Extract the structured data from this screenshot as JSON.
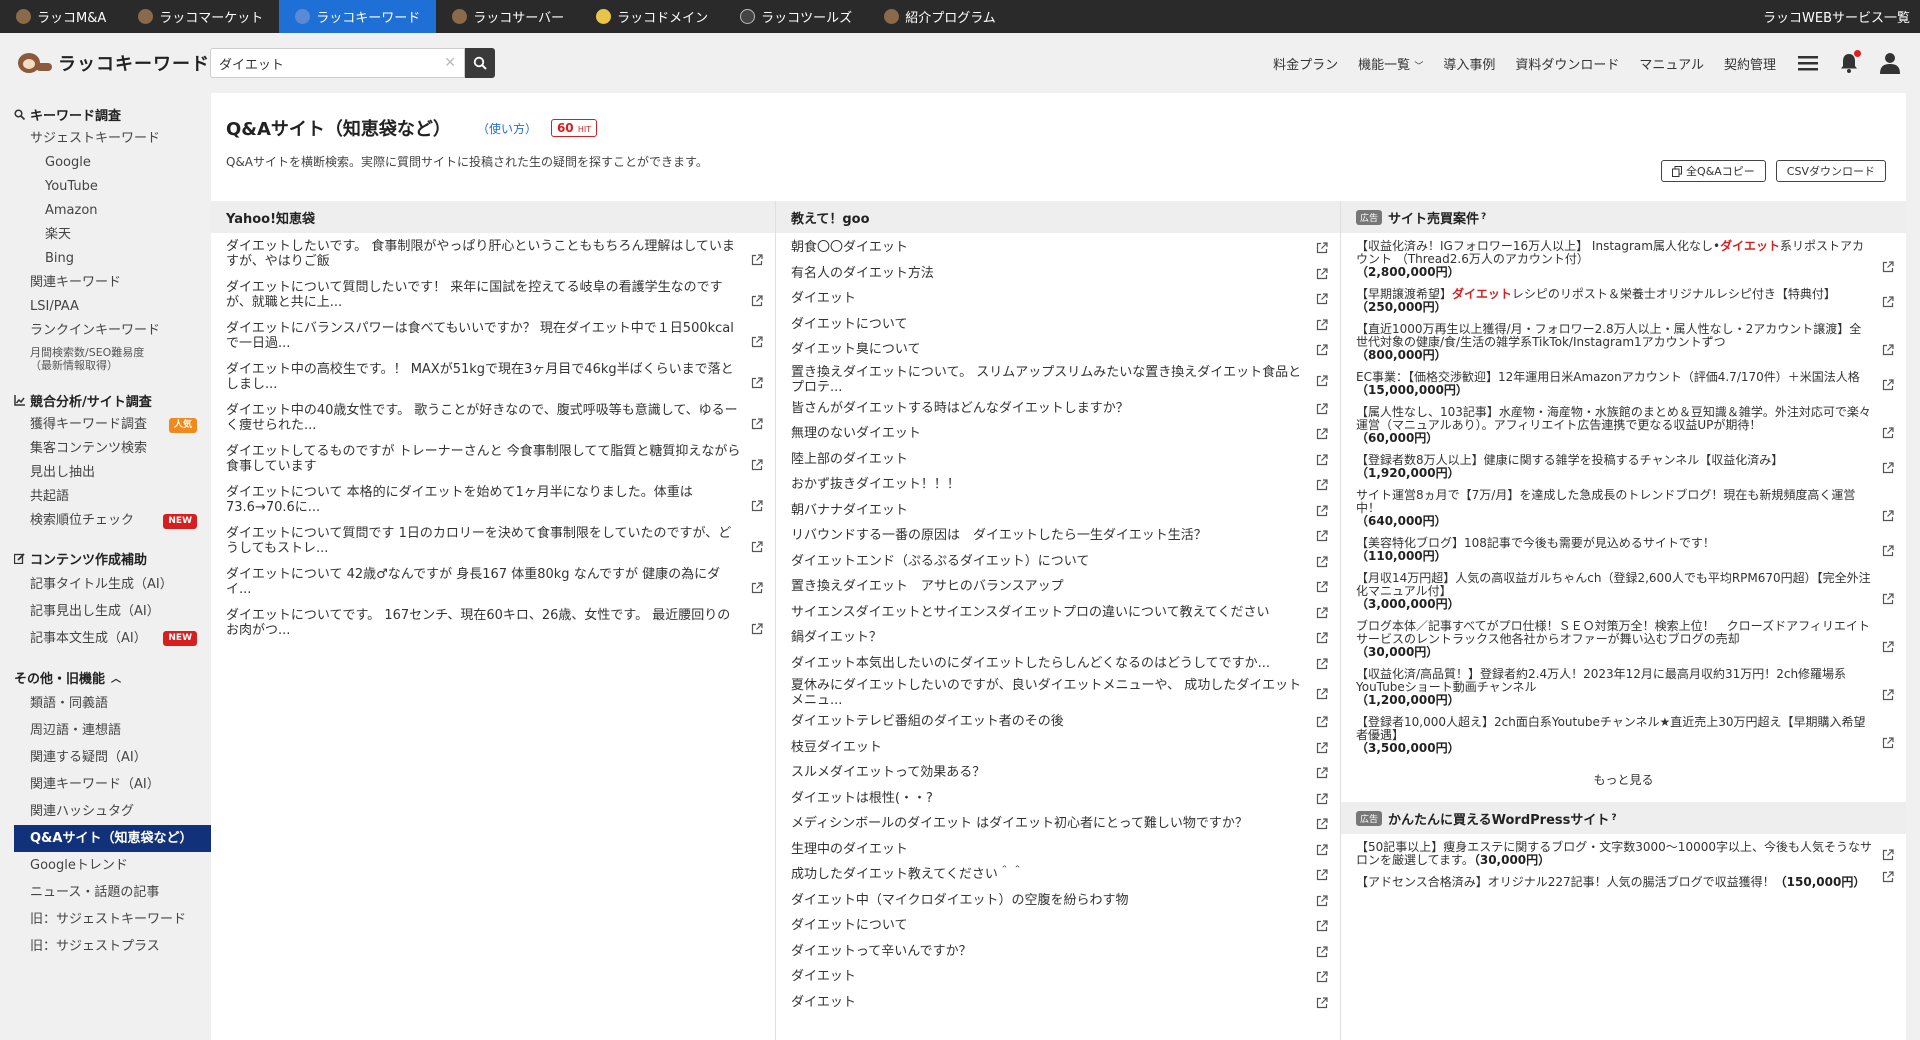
{
  "service_bar": {
    "items": [
      {
        "label": "ラッコM&A",
        "active": false
      },
      {
        "label": "ラッコマーケット",
        "active": false
      },
      {
        "label": "ラッコキーワード",
        "active": true
      },
      {
        "label": "ラッコサーバー",
        "active": false
      },
      {
        "label": "ラッコドメイン",
        "active": false
      },
      {
        "label": "ラッコツールズ",
        "active": false
      },
      {
        "label": "紹介プログラム",
        "active": false
      }
    ],
    "right_label": "ラッコWEBサービス一覧"
  },
  "header": {
    "logo_text": "ラッコキーワード",
    "search_value": "ダイエット",
    "nav": [
      "料金プラン",
      "機能一覧",
      "導入事例",
      "資料ダウンロード",
      "マニュアル",
      "契約管理"
    ]
  },
  "sidebar": {
    "sections": [
      {
        "title": "キーワード調査",
        "items": [
          "サジェストキーワード",
          "Google",
          "YouTube",
          "Amazon",
          "楽天",
          "Bing",
          "関連キーワード",
          "LSI/PAA",
          "ランクインキーワード",
          "月間検索数/SEO難易度",
          "（最新情報取得）"
        ]
      },
      {
        "title": "競合分析/サイト調査",
        "items": [
          "獲得キーワード調査",
          "集客コンテンツ検索",
          "見出し抽出",
          "共起語",
          "検索順位チェック"
        ],
        "badges": {
          "popular": "人気",
          "new": "NEW"
        }
      },
      {
        "title": "コンテンツ作成補助",
        "items": [
          "記事タイトル生成（AI）",
          "記事見出し生成（AI）",
          "記事本文生成（AI）"
        ]
      },
      {
        "title": "その他・旧機能",
        "items": [
          "類語・同義語",
          "周辺語・連想語",
          "関連する疑問（AI）",
          "関連キーワード（AI）",
          "関連ハッシュタグ",
          "Q&Aサイト（知恵袋など）",
          "Googleトレンド",
          "ニュース・話題の記事",
          "旧：サジェストキーワード",
          "旧：サジェストプラス"
        ]
      }
    ]
  },
  "page": {
    "title": "Q&Aサイト（知恵袋など）",
    "help_link": "（使い方）",
    "hit_count": "60",
    "hit_unit": "HIT",
    "description": "Q&Aサイトを横断検索。実際に質問サイトに投稿された生の疑問を探すことができます。",
    "copy_button": "全Q&Aコピー",
    "csv_button": "CSVダウンロード"
  },
  "yahoo": {
    "header": "Yahoo!知恵袋",
    "rows": [
      "ダイエットしたいです。 食事制限がやっぱり肝心ということももちろん理解はしていますが、やはりご飯",
      "ダイエットについて質問したいです！ 来年に国試を控えてる岐阜の看護学生なのですが、就職と共に上...",
      "ダイエットにバランスパワーは食べてもいいですか？ 現在ダイエット中で１日500kcalで一日過...",
      "ダイエット中の高校生です。！ MAXが51kgで現在3ヶ月目で46kg半ばくらいまで落としまし...",
      "ダイエット中の40歳女性です。 歌うことが好きなので、腹式呼吸等も意識して、ゆるーく痩せられた...",
      "ダイエットしてるものですが トレーナーさんと 今食事制限してて脂質と糖質抑えながら食事しています",
      "ダイエットについて 本格的にダイエットを始めて1ヶ月半になりました。体重は73.6→70.6に...",
      "ダイエットについて質問です 1日のカロリーを決めて食事制限をしていたのですが、どうしてもストレ...",
      "ダイエットについて 42歳♂なんですが 身長167 体重80kg なんですが 健康の為にダイ...",
      "ダイエットについてです。 167センチ、現在60キロ、26歳、女性です。 最近腰回りのお肉がつ..."
    ]
  },
  "goo": {
    "header": "教えて！goo",
    "rows": [
      "朝食〇〇ダイエット",
      "有名人のダイエット方法",
      "ダイエット",
      "ダイエットについて",
      "ダイエット臭について",
      "置き換えダイエットについて。 スリムアップスリムみたいな置き換えダイエット食品とプロテ...",
      "皆さんがダイエットする時はどんなダイエットしますか？",
      "無理のないダイエット",
      "陸上部のダイエット",
      "おかず抜きダイエット！！！",
      "朝バナナダイエット",
      "リバウンドする一番の原因は　ダイエットしたら一生ダイエット生活？",
      "ダイエットエンド（ぷるぷるダイエット）について",
      "置き換えダイエット　アサヒのバランスアップ",
      "サイエンスダイエットとサイエンスダイエットプロの違いについて教えてください",
      "鍋ダイエット？",
      "ダイエット本気出したいのにダイエットしたらしんどくなるのはどうしてですか...",
      "夏休みにダイエットしたいのですが、良いダイエットメニューや、 成功したダイエットメニュ...",
      "ダイエットテレビ番組のダイエット者のその後",
      "枝豆ダイエット",
      "スルメダイエットって効果ある？",
      "ダイエットは根性(・・?",
      "メディシンボールのダイエット はダイエット初心者にとって難しい物ですか？",
      "生理中のダイエット",
      "成功したダイエット教えてください＾＾",
      "ダイエット中（マイクロダイエット）の空腹を紛らわす物",
      "ダイエットについて",
      "ダイエットって辛いんですか？",
      "ダイエット",
      "ダイエット"
    ]
  },
  "ads": {
    "tag": "広告",
    "header": "サイト売買案件",
    "qmark": "?",
    "rows": [
      {
        "pre": "【収益化済み！IGフォロワー16万人以上】 Instagram属人化なし•",
        "hl": "ダイエット",
        "post": "系リポストアカウント （Thread2.6万人のアカウント付）",
        "price": "（2,800,000円）"
      },
      {
        "pre": "【早期譲渡希望】",
        "hl": "ダイエット",
        "post": "レシピのリポスト＆栄養士オリジナルレシピ付き【特典付】",
        "price": "（250,000円）"
      },
      {
        "pre": "【直近1000万再生以上獲得/月・フォロワー2.8万人以上・属人性なし・2アカウント譲渡】全世代対象の健康/食/生活の雑学系TikTok/Instagram1アカウントずつ",
        "hl": "",
        "post": "",
        "price": "（800,000円）"
      },
      {
        "pre": "EC事業：【価格交渉歓迎】12年運用日米Amazonアカウント（評価4.7/170件）＋米国法人格",
        "hl": "",
        "post": "",
        "price": "（15,000,000円）"
      },
      {
        "pre": "【属人性なし、103記事】水産物・海産物・水族館のまとめ＆豆知識＆雑学。外注対応可で楽々運営（マニュアルあり）。アフィリエイト広告連携で更なる収益UPが期待！",
        "hl": "",
        "post": "",
        "price": "（60,000円）"
      },
      {
        "pre": "【登録者数8万人以上】健康に関する雑学を投稿するチャンネル【収益化済み】",
        "hl": "",
        "post": "",
        "price": "（1,920,000円）"
      },
      {
        "pre": "サイト運営8ヵ月で【7万/月】を達成した急成長のトレンドブログ！現在も新規頻度高く運営中！",
        "hl": "",
        "post": "",
        "price": "（640,000円）"
      },
      {
        "pre": "【美容特化ブログ】108記事で今後も需要が見込めるサイトです！",
        "hl": "",
        "post": "",
        "price": "（110,000円）"
      },
      {
        "pre": "【月収14万円超】人気の高収益ガルちゃんch（登録2,600人でも平均RPM670円超）【完全外注化マニュアル付】",
        "hl": "",
        "post": "",
        "price": "（3,000,000円）"
      },
      {
        "pre": "ブログ本体／記事すべてがプロ仕様！ＳＥＯ対策万全！検索上位！　クローズドアフィリエイトサービスのレントラックス他各社からオファーが舞い込むブログの売却",
        "hl": "",
        "post": "",
        "price": "（30,000円）"
      },
      {
        "pre": "【収益化済/高品質！】登録者約2.4万人！2023年12月に最高月収約31万円！2ch修羅場系YouTubeショート動画チャンネル",
        "hl": "",
        "post": "",
        "price": "（1,200,000円）"
      },
      {
        "pre": "【登録者10,000人超え】2ch面白系Youtubeチャンネル★直近売上30万円超え【早期購入希望者優遇】",
        "hl": "",
        "post": "",
        "price": "（3,500,000円）"
      }
    ],
    "more": "もっと見る",
    "wp_tag": "広告",
    "wp_header": "かんたんに買えるWordPressサイト",
    "wp_qmark": "?",
    "wp_rows": [
      {
        "pre": "【50記事以上】痩身エステに関するブログ・文字数3000〜10000字以上、今後も人気そうなサロンを厳選してます。",
        "price": "（30,000円）"
      },
      {
        "pre": "【アドセンス合格済み】オリジナル227記事！人気の腸活ブログで収益獲得！",
        "price": "（150,000円）"
      }
    ]
  }
}
